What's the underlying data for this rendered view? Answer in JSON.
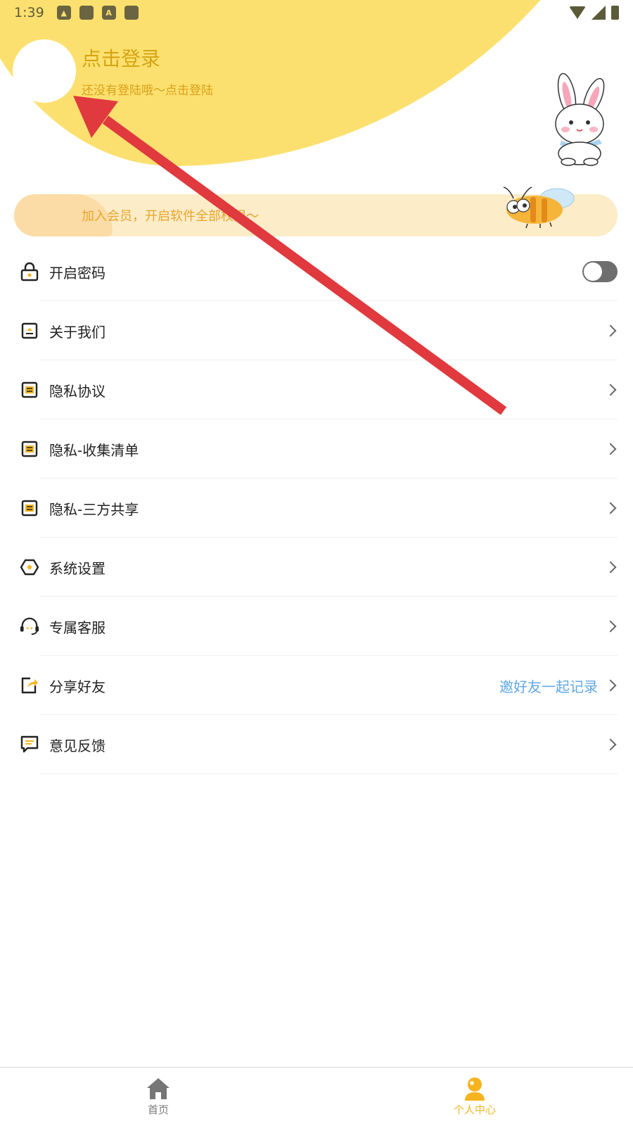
{
  "status_bar": {
    "time": "1:39",
    "icons": [
      "image-icon",
      "app-icon",
      "a-icon",
      "app-icon",
      "wifi-icon",
      "signal-icon",
      "battery-icon"
    ]
  },
  "header": {
    "login_title": "点击登录",
    "login_subtitle": "还没有登陆哦～点击登陆"
  },
  "member_banner": {
    "text": "加入会员，开启软件全部权限～"
  },
  "menu": [
    {
      "label": "开启密码",
      "icon": "lock-icon",
      "right": "toggle",
      "toggle_on": false
    },
    {
      "label": "关于我们",
      "icon": "about-icon",
      "right": "chevron"
    },
    {
      "label": "隐私协议",
      "icon": "document-icon",
      "right": "chevron"
    },
    {
      "label": "隐私-收集清单",
      "icon": "document-icon",
      "right": "chevron"
    },
    {
      "label": "隐私-三方共享",
      "icon": "document-icon",
      "right": "chevron"
    },
    {
      "label": "系统设置",
      "icon": "settings-icon",
      "right": "chevron"
    },
    {
      "label": "专属客服",
      "icon": "headset-icon",
      "right": "chevron"
    },
    {
      "label": "分享好友",
      "icon": "share-icon",
      "right": "chevron",
      "hint": "邀好友一起记录"
    },
    {
      "label": "意见反馈",
      "icon": "feedback-icon",
      "right": "chevron"
    }
  ],
  "bottom_nav": {
    "home_label": "首页",
    "profile_label": "个人中心",
    "active": "profile"
  },
  "colors": {
    "header_yellow": "#fce06f",
    "accent_orange": "#e7a52a",
    "hint_blue": "#5fa8e6",
    "annotation_red": "#e0393e"
  }
}
